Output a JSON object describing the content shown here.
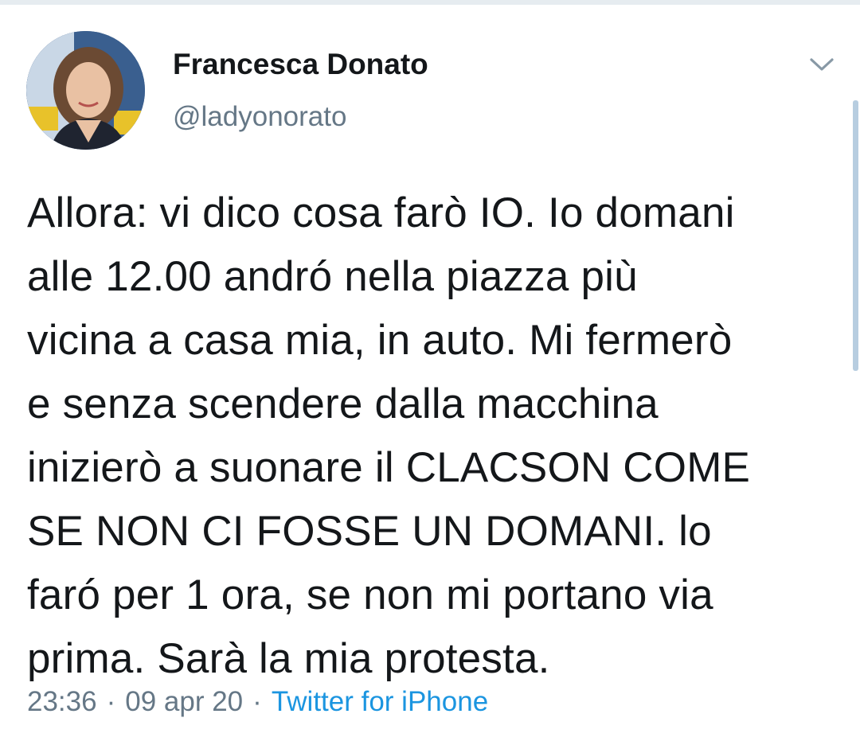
{
  "author": {
    "display_name": "Francesca Donato",
    "handle": "@ladyonorato",
    "avatar_icon": "profile-photo"
  },
  "header": {
    "more_icon": "chevron-down-icon"
  },
  "tweet": {
    "text": "Allora: vi dico cosa farò IO. Io domani\nalle 12.00 andró nella piazza più\nvicina a casa mia, in auto. Mi fermerò\ne senza scendere dalla macchina\ninizierò a suonare il CLACSON COME\nSE NON CI FOSSE UN DOMANI. lo\nfaró per 1 ora, se non mi portano via\nprima. Sarà la mia protesta."
  },
  "meta": {
    "time": "23:36",
    "separator": "·",
    "date": "09 apr 20",
    "source": "Twitter for iPhone"
  },
  "colors": {
    "text": "#14171a",
    "secondary": "#657786",
    "link": "#1b95e0",
    "scrollbar": "#b7cde0"
  }
}
